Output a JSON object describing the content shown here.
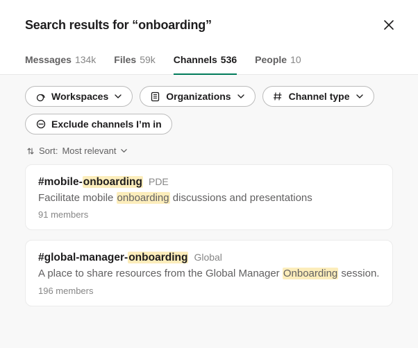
{
  "header": {
    "title": "Search results for “onboarding”"
  },
  "tabs": [
    {
      "label": "Messages",
      "count": "134k"
    },
    {
      "label": "Files",
      "count": "59k"
    },
    {
      "label": "Channels",
      "count": "536"
    },
    {
      "label": "People",
      "count": "10"
    }
  ],
  "filters": {
    "workspaces": "Workspaces",
    "organizations": "Organizations",
    "channel_type": "Channel type",
    "exclude": "Exclude channels I’m in"
  },
  "sort": {
    "prefix": "Sort:",
    "value": "Most relevant"
  },
  "results": [
    {
      "name_pre": "#mobile-",
      "name_hl": "onboarding",
      "name_post": "",
      "tag": "PDE",
      "desc_pre": "Facilitate mobile ",
      "desc_hl": "onboarding",
      "desc_post": " discussions and presentations",
      "members": "91 members"
    },
    {
      "name_pre": "#global-manager-",
      "name_hl": "onboarding",
      "name_post": "",
      "tag": "Global",
      "desc_pre": "A place to share resources from the Global Manager ",
      "desc_hl": "Onboarding",
      "desc_post": " session.",
      "members": "196 members"
    }
  ]
}
